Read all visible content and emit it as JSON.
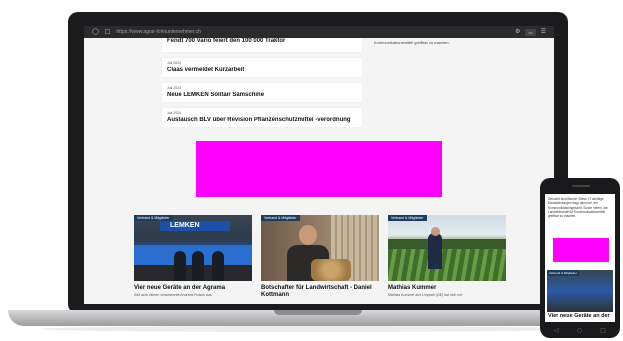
{
  "browser": {
    "url": "https://www.agrar-lohnunternehmer.ch",
    "icons": [
      "shield-icon",
      "lock-icon"
    ],
    "badge": "•••"
  },
  "news": [
    {
      "date": "",
      "title": "Fendt 700 Vario feiert den 100 000 Traktor"
    },
    {
      "date": "Juli 2024",
      "title": "Claas vermeldet Kurzarbeit"
    },
    {
      "date": "Juli 2024",
      "title": "Neue LEMKEN Solitair Sämschine"
    },
    {
      "date": "Juli 2024",
      "title": "Austausch BLV über Revision Pflanzenschutzmittel -verordnung"
    }
  ],
  "sidebar_text": "Kommunikationsmittel greifbar zu machen.",
  "ad": {
    "color": "#ff00ff"
  },
  "tiles": [
    {
      "tag": "Verband & Mitglieder",
      "banner": "LEMKEN",
      "title": "Vier neue Geräte an der Agrama",
      "sub": "Seit acht Jahren verantwortet Andreas Rutsch das"
    },
    {
      "tag": "Verband & Mitglieder",
      "title": "Botschafter für Landwirtschaft - Daniel Kottmann",
      "sub": ""
    },
    {
      "tag": "Verband & Mitglieder",
      "title": "Mathias Kummer",
      "sub": "Mathias Kummer aus Limpach (BE) hat sich mit"
    }
  ],
  "phone": {
    "text": "Gesucht sind Berufe: Diese 17 wichtige Dienstleistungen tragt dazu bei, ein Kommunikationsgesicht. Sowie helfen, die Landwirtschaft für Kommunikationsmittel greifbar zu machen.",
    "tag": "Verband & Mitglieder",
    "title": "Vier neue Geräte an der",
    "nav": [
      "◁",
      "○",
      "□"
    ]
  }
}
